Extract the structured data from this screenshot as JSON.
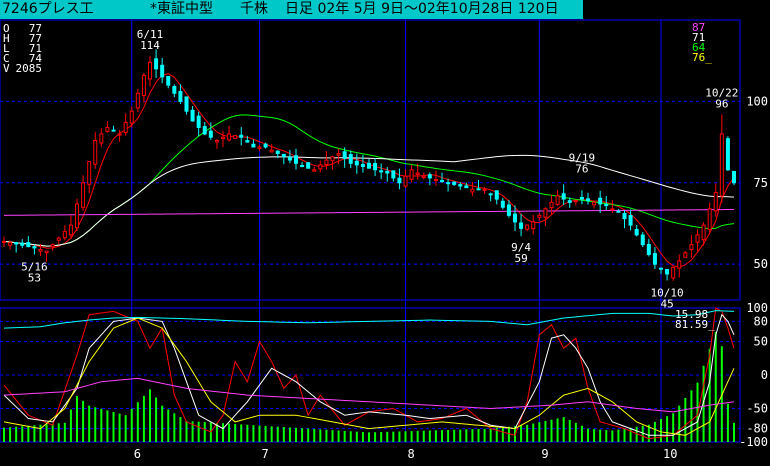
{
  "title": {
    "code_name": "7246プレス工",
    "market": "*東証中型",
    "trading_unit": "千株",
    "period": "日足 02年 5月 9日～02年10月28日 120日"
  },
  "ohlc_panel": [
    {
      "label": "O",
      "value": "77"
    },
    {
      "label": "H",
      "value": "77"
    },
    {
      "label": "L",
      "value": "71"
    },
    {
      "label": "C",
      "value": "74"
    },
    {
      "label": "V",
      "value": "2085"
    }
  ],
  "ma_legend": [
    {
      "value": "87",
      "color": "#ff40ff"
    },
    {
      "value": "71",
      "color": "#ffffff"
    },
    {
      "value": "64",
      "color": "#00ff00"
    },
    {
      "value": "76_",
      "color": "#ffff00"
    }
  ],
  "osc_legend": [
    {
      "value": "15.98",
      "color": "#ffffff"
    },
    {
      "value": "81.59_",
      "color": "#ffffff"
    }
  ],
  "colors": {
    "title_bg": "#00c8c8",
    "grid": "#0000ff",
    "candle_up": "#ff0000",
    "candle_down": "#00ffff",
    "ma_short": "#ff0000",
    "ma_mid": "#00ff00",
    "ma_long": "#ffffff",
    "ma_xlong": "#ff40ff",
    "volume": "#00ff00"
  },
  "chart_data": {
    "type": "candlestick",
    "x_ticks": [
      "6",
      "7",
      "8",
      "9",
      "10"
    ],
    "price_axis": {
      "ticks": [
        50,
        75,
        100
      ],
      "range": [
        39,
        125
      ]
    },
    "osc_axis": {
      "ticks": [
        100,
        80,
        50,
        0,
        -50,
        -80,
        -100
      ],
      "range": [
        -100,
        100
      ]
    },
    "price_annotations": [
      {
        "date": "5/16",
        "value": "53",
        "position": "below"
      },
      {
        "date": "6/11",
        "value": "114",
        "position": "above"
      },
      {
        "date": "9/4",
        "value": "59",
        "position": "below"
      },
      {
        "date": "9/19",
        "value": "76",
        "position": "above"
      },
      {
        "date": "10/10",
        "value": "45",
        "position": "below"
      },
      {
        "date": "10/22",
        "value": "96",
        "position": "above"
      }
    ],
    "close_keypoints": [
      [
        0,
        57
      ],
      [
        5,
        55
      ],
      [
        7,
        54
      ],
      [
        9,
        58
      ],
      [
        11,
        62
      ],
      [
        13,
        75
      ],
      [
        15,
        88
      ],
      [
        17,
        92
      ],
      [
        19,
        90
      ],
      [
        21,
        97
      ],
      [
        23,
        108
      ],
      [
        24,
        112
      ],
      [
        25,
        110
      ],
      [
        27,
        105
      ],
      [
        29,
        100
      ],
      [
        31,
        94
      ],
      [
        33,
        90
      ],
      [
        35,
        88
      ],
      [
        37,
        90
      ],
      [
        39,
        89
      ],
      [
        41,
        86
      ],
      [
        43,
        86
      ],
      [
        45,
        84
      ],
      [
        47,
        82
      ],
      [
        49,
        80
      ],
      [
        51,
        79
      ],
      [
        53,
        82
      ],
      [
        55,
        84
      ],
      [
        57,
        81
      ],
      [
        59,
        80
      ],
      [
        61,
        79
      ],
      [
        63,
        78
      ],
      [
        65,
        75
      ],
      [
        67,
        79
      ],
      [
        69,
        77
      ],
      [
        71,
        76
      ],
      [
        73,
        75
      ],
      [
        75,
        74
      ],
      [
        77,
        73
      ],
      [
        79,
        73
      ],
      [
        81,
        70
      ],
      [
        83,
        65
      ],
      [
        85,
        61
      ],
      [
        87,
        63
      ],
      [
        89,
        67
      ],
      [
        91,
        71
      ],
      [
        93,
        69
      ],
      [
        95,
        70
      ],
      [
        97,
        69
      ],
      [
        99,
        68
      ],
      [
        101,
        66
      ],
      [
        103,
        62
      ],
      [
        105,
        56
      ],
      [
        107,
        50
      ],
      [
        109,
        47
      ],
      [
        111,
        51
      ],
      [
        113,
        56
      ],
      [
        115,
        62
      ],
      [
        117,
        72
      ],
      [
        118,
        90
      ],
      [
        119,
        79
      ],
      [
        120,
        75
      ]
    ],
    "volume_keypoints": [
      [
        0,
        15
      ],
      [
        10,
        20
      ],
      [
        12,
        48
      ],
      [
        14,
        38
      ],
      [
        20,
        28
      ],
      [
        24,
        55
      ],
      [
        26,
        38
      ],
      [
        30,
        22
      ],
      [
        40,
        18
      ],
      [
        50,
        14
      ],
      [
        60,
        10
      ],
      [
        70,
        12
      ],
      [
        80,
        14
      ],
      [
        86,
        18
      ],
      [
        92,
        26
      ],
      [
        96,
        14
      ],
      [
        100,
        12
      ],
      [
        106,
        18
      ],
      [
        110,
        30
      ],
      [
        114,
        62
      ],
      [
        117,
        115
      ],
      [
        118,
        100
      ],
      [
        119,
        40
      ],
      [
        120,
        20
      ]
    ],
    "series": [
      {
        "name": "",
        "kind": "ma",
        "color": "#ff0000",
        "source": "ma_5"
      },
      {
        "name": "",
        "kind": "ma",
        "color": "#00ff00",
        "source": "ma_25"
      },
      {
        "name": "",
        "kind": "ma",
        "color": "#ffffff",
        "source": "ma_75"
      },
      {
        "name": "",
        "kind": "ma",
        "color": "#ff40ff",
        "source": "ma_long"
      }
    ],
    "oscillators": [
      {
        "color": "#ff0000",
        "points": [
          [
            0,
            -15
          ],
          [
            4,
            -60
          ],
          [
            8,
            -75
          ],
          [
            12,
            30
          ],
          [
            14,
            90
          ],
          [
            18,
            95
          ],
          [
            22,
            80
          ],
          [
            24,
            40
          ],
          [
            26,
            70
          ],
          [
            28,
            -30
          ],
          [
            30,
            -70
          ],
          [
            34,
            -85
          ],
          [
            36,
            -60
          ],
          [
            38,
            20
          ],
          [
            40,
            -10
          ],
          [
            42,
            50
          ],
          [
            44,
            20
          ],
          [
            46,
            -20
          ],
          [
            48,
            0
          ],
          [
            50,
            -60
          ],
          [
            52,
            -30
          ],
          [
            56,
            -75
          ],
          [
            60,
            -55
          ],
          [
            64,
            -50
          ],
          [
            68,
            -70
          ],
          [
            72,
            -65
          ],
          [
            76,
            -50
          ],
          [
            80,
            -80
          ],
          [
            84,
            -90
          ],
          [
            86,
            -40
          ],
          [
            88,
            60
          ],
          [
            90,
            75
          ],
          [
            92,
            40
          ],
          [
            94,
            55
          ],
          [
            96,
            -20
          ],
          [
            98,
            -70
          ],
          [
            102,
            -80
          ],
          [
            106,
            -95
          ],
          [
            110,
            -90
          ],
          [
            114,
            -60
          ],
          [
            116,
            30
          ],
          [
            117,
            100
          ],
          [
            118,
            95
          ],
          [
            119,
            70
          ],
          [
            120,
            40
          ]
        ]
      },
      {
        "color": "#ffffff",
        "points": [
          [
            0,
            -30
          ],
          [
            4,
            -65
          ],
          [
            8,
            -70
          ],
          [
            12,
            -20
          ],
          [
            14,
            40
          ],
          [
            18,
            80
          ],
          [
            22,
            85
          ],
          [
            26,
            80
          ],
          [
            28,
            40
          ],
          [
            30,
            -10
          ],
          [
            32,
            -60
          ],
          [
            36,
            -80
          ],
          [
            40,
            -40
          ],
          [
            44,
            10
          ],
          [
            48,
            -10
          ],
          [
            52,
            -40
          ],
          [
            56,
            -60
          ],
          [
            60,
            -55
          ],
          [
            66,
            -60
          ],
          [
            70,
            -65
          ],
          [
            76,
            -60
          ],
          [
            80,
            -75
          ],
          [
            84,
            -80
          ],
          [
            88,
            -10
          ],
          [
            90,
            55
          ],
          [
            92,
            60
          ],
          [
            94,
            40
          ],
          [
            96,
            10
          ],
          [
            98,
            -40
          ],
          [
            100,
            -70
          ],
          [
            106,
            -90
          ],
          [
            110,
            -90
          ],
          [
            114,
            -70
          ],
          [
            116,
            -10
          ],
          [
            117,
            60
          ],
          [
            118,
            90
          ],
          [
            119,
            80
          ],
          [
            120,
            60
          ]
        ]
      },
      {
        "color": "#ffff00",
        "points": [
          [
            0,
            -70
          ],
          [
            6,
            -80
          ],
          [
            10,
            -50
          ],
          [
            14,
            20
          ],
          [
            18,
            70
          ],
          [
            22,
            85
          ],
          [
            26,
            70
          ],
          [
            30,
            20
          ],
          [
            34,
            -40
          ],
          [
            38,
            -70
          ],
          [
            42,
            -60
          ],
          [
            48,
            -60
          ],
          [
            54,
            -70
          ],
          [
            60,
            -80
          ],
          [
            66,
            -75
          ],
          [
            72,
            -70
          ],
          [
            78,
            -75
          ],
          [
            84,
            -80
          ],
          [
            88,
            -60
          ],
          [
            92,
            -30
          ],
          [
            96,
            -20
          ],
          [
            100,
            -40
          ],
          [
            104,
            -70
          ],
          [
            108,
            -85
          ],
          [
            112,
            -90
          ],
          [
            116,
            -70
          ],
          [
            118,
            -30
          ],
          [
            120,
            10
          ]
        ]
      },
      {
        "color": "#00ffff",
        "points": [
          [
            0,
            70
          ],
          [
            6,
            72
          ],
          [
            10,
            78
          ],
          [
            14,
            82
          ],
          [
            18,
            85
          ],
          [
            22,
            86
          ],
          [
            30,
            84
          ],
          [
            40,
            80
          ],
          [
            50,
            78
          ],
          [
            60,
            80
          ],
          [
            70,
            82
          ],
          [
            80,
            80
          ],
          [
            86,
            75
          ],
          [
            92,
            85
          ],
          [
            100,
            92
          ],
          [
            106,
            92
          ],
          [
            110,
            88
          ],
          [
            114,
            90
          ],
          [
            117,
            96
          ],
          [
            120,
            95
          ]
        ]
      },
      {
        "color": "#ff40ff",
        "points": [
          [
            0,
            -30
          ],
          [
            10,
            -25
          ],
          [
            16,
            -10
          ],
          [
            22,
            -5
          ],
          [
            30,
            -20
          ],
          [
            40,
            -30
          ],
          [
            50,
            -35
          ],
          [
            60,
            -40
          ],
          [
            70,
            -45
          ],
          [
            80,
            -50
          ],
          [
            90,
            -45
          ],
          [
            96,
            -40
          ],
          [
            104,
            -50
          ],
          [
            110,
            -55
          ],
          [
            116,
            -45
          ],
          [
            120,
            -40
          ]
        ]
      }
    ]
  }
}
